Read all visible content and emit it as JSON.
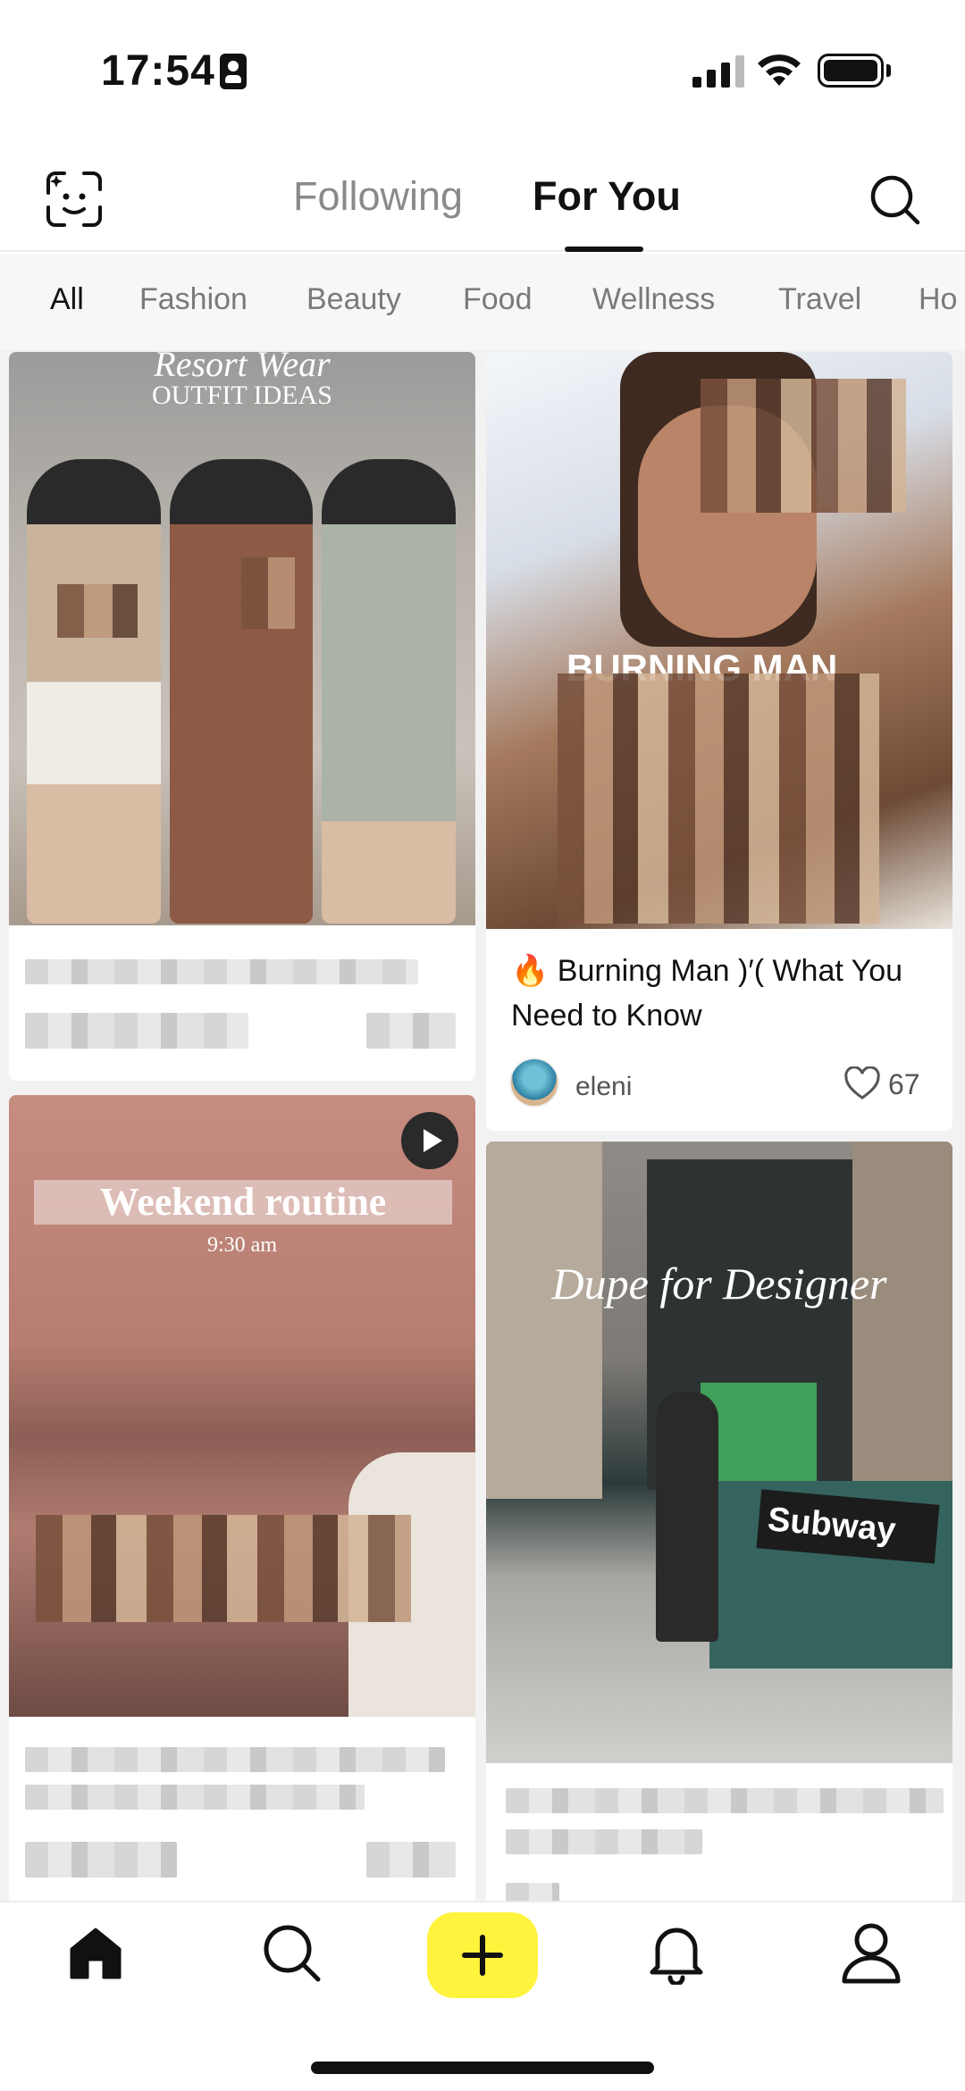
{
  "status_bar": {
    "time": "17:54"
  },
  "header": {
    "tabs": [
      {
        "label": "Following",
        "active": false
      },
      {
        "label": "For You",
        "active": true
      }
    ]
  },
  "categories": [
    "All",
    "Fashion",
    "Beauty",
    "Food",
    "Wellness",
    "Travel",
    "Ho"
  ],
  "feed": {
    "card1": {
      "overlay_title": "Resort Wear",
      "overlay_subtitle": "OUTFIT IDEAS"
    },
    "card2": {
      "overlay_text": "BURNING MAN",
      "title": "🔥 Burning Man )′( What You Need to Know",
      "author": "eleni",
      "likes": "67"
    },
    "card3": {
      "overlay_title": "Weekend routine",
      "overlay_subtitle": "9:30 am"
    },
    "card4": {
      "overlay_title": "Dupe for Designer",
      "sign_text": "Subway"
    }
  },
  "icons": {
    "face": "face-scan-icon",
    "search": "search-icon",
    "like": "heart-icon",
    "play": "play-icon",
    "tabbar": [
      "home-icon",
      "search-icon",
      "plus-icon",
      "bell-icon",
      "profile-icon"
    ]
  },
  "colors": {
    "accent": "#fff33d",
    "text": "#111111",
    "muted": "#8a8a8a"
  }
}
